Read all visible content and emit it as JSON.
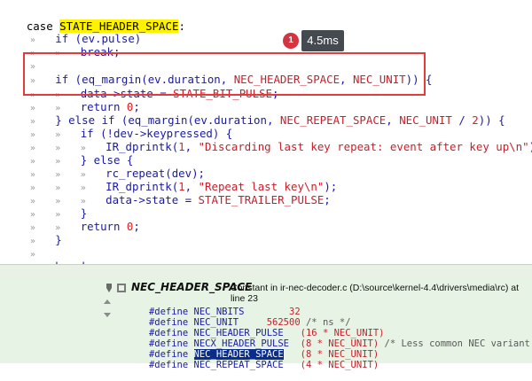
{
  "code": {
    "l0_case": "case",
    "l0_state": "STATE_HEADER_SPACE",
    "l0_colon": ":",
    "l1": "if (ev.pulse)",
    "l2": "break;",
    "l4_if": "if",
    "l4_rest": " (eq_margin(ev.duration, ",
    "l4_m1": "NEC_HEADER_SPACE",
    "l4_m2": "NEC_UNIT",
    "l4_end": ")) {",
    "l5_a": "data->state = ",
    "l5_m": "STATE_BIT_PULSE",
    "l5_end": ";",
    "l6_a": "return ",
    "l6_n": "0",
    "l6_end": ";",
    "l7_a": "} else if (eq_margin(ev.duration, ",
    "l7_m1": "NEC_REPEAT_SPACE",
    "l7_m2": "NEC_UNIT",
    "l7_n": "2",
    "l7_end": ")) {",
    "l8": "if (!dev->keypressed) {",
    "l9_a": "IR_dprintk(",
    "l9_n": "1",
    "l9_s": "\"Discarding last key repeat: event after key up\\n\"",
    "l9_end": ");",
    "l10": "} else {",
    "l11": "rc_repeat(dev);",
    "l12_a": "IR_dprintk(",
    "l12_n": "1",
    "l12_s": "\"Repeat last key\\n\"",
    "l12_end": ");",
    "l13_a": "data->state = ",
    "l13_m": "STATE_TRAILER_PULSE",
    "l13_end": ";",
    "l14": "}",
    "l15_a": "return ",
    "l15_n": "0",
    "l15_end": ";",
    "l16": "}",
    "l18": "break;"
  },
  "tooltip": {
    "badge": "1",
    "text": "4.5ms"
  },
  "symbol_panel": {
    "title": "NEC_HEADER_SPACE",
    "desc": "Constant in ir-nec-decoder.c (D:\\source\\kernel-4.4\\drivers\\media\\rc) at line 23",
    "defines": [
      {
        "pp": "#define",
        "name": "NEC_NBITS",
        "value": "32",
        "comment": ""
      },
      {
        "pp": "#define",
        "name": "NEC_UNIT",
        "value": "562500",
        "comment": "/* ns */"
      },
      {
        "pp": "#define",
        "name": "NEC_HEADER_PULSE",
        "value": "(16 * NEC_UNIT)",
        "comment": ""
      },
      {
        "pp": "#define",
        "name": "NECX_HEADER_PULSE",
        "value": "(8 * NEC_UNIT)",
        "comment": "/* Less common NEC variant */"
      },
      {
        "pp": "#define",
        "name": "NEC_HEADER_SPACE",
        "value": "(8 * NEC_UNIT)",
        "comment": ""
      },
      {
        "pp": "#define",
        "name": "NEC_REPEAT_SPACE",
        "value": "(4 * NEC_UNIT)",
        "comment": ""
      }
    ]
  },
  "colors": {
    "keyword": "#1a1aa6",
    "macro": "#c71f2a",
    "highlight": "#fff200",
    "selection": "#0b2d8a",
    "panel_bg": "#e7f3e4"
  }
}
